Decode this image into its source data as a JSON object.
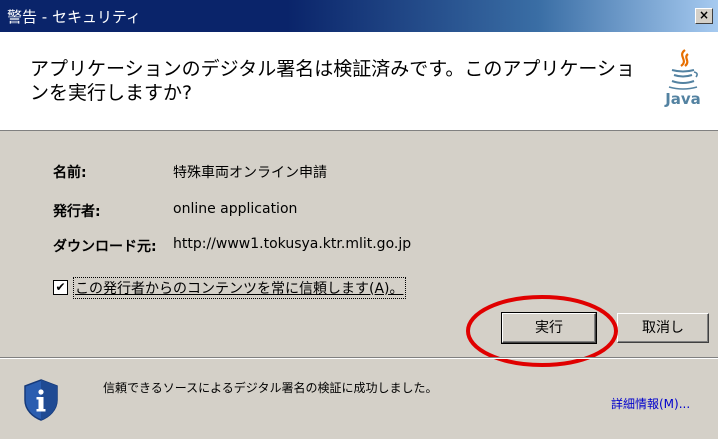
{
  "window": {
    "title": "警告 - セキュリティ",
    "close_glyph": "×"
  },
  "header": {
    "message": "アプリケーションのデジタル署名は検証済みです。このアプリケーションを実行しますか?",
    "logo_text": "Java"
  },
  "info": {
    "name_label": "名前:",
    "name_value": "特殊車両オンライン申請",
    "publisher_label": "発行者:",
    "publisher_value": "online application",
    "from_label": "ダウンロード元:",
    "from_value": "http://www1.tokusya.ktr.mlit.go.jp"
  },
  "trust_checkbox": {
    "label": "この発行者からのコンテンツを常に信頼します(A)。",
    "checked": true,
    "check_glyph": "✔"
  },
  "buttons": {
    "run": "実行",
    "cancel": "取消し"
  },
  "footer": {
    "message": "信頼できるソースによるデジタル署名の検証に成功しました。",
    "details_link": "詳細情報(M)..."
  },
  "colors": {
    "title_bar": "#0a246a",
    "dialog_bg": "#d4d0c8",
    "highlight_ellipse": "#e00000",
    "link": "#0000cc"
  }
}
